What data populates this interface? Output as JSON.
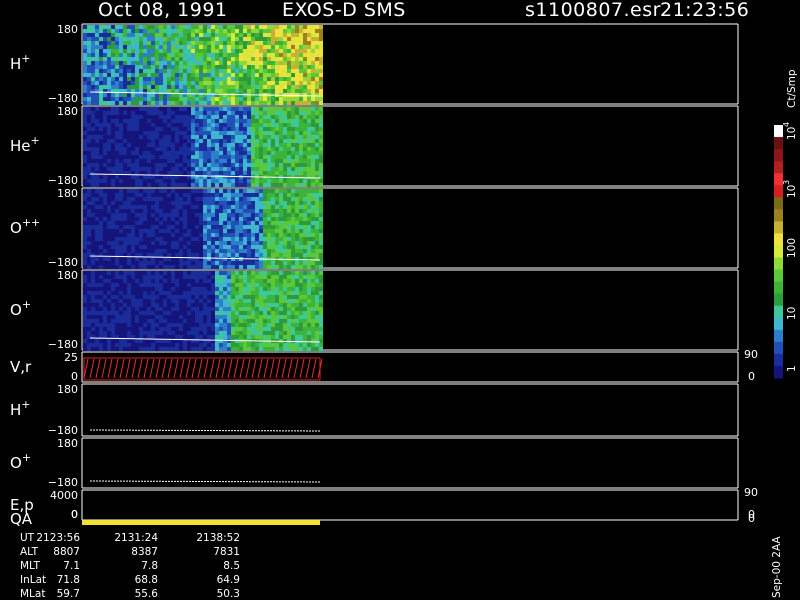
{
  "header": {
    "date": "Oct 08, 1991",
    "mission": "EXOS-D SMS",
    "file": "s1100807.esr",
    "time": "21:23:56"
  },
  "panels": [
    {
      "label": "H",
      "sup": "+",
      "ymax": "180",
      "ymin": "−180"
    },
    {
      "label": "He",
      "sup": "+",
      "ymax": "180",
      "ymin": "−180"
    },
    {
      "label": "O",
      "sup": "++",
      "ymax": "180",
      "ymin": "−180"
    },
    {
      "label": "O",
      "sup": "+",
      "ymax": "180",
      "ymin": "−180"
    },
    {
      "label": "V,r",
      "sup": "",
      "ymax": "25",
      "ymin": "0",
      "rtop": "90",
      "rbot": "0"
    },
    {
      "label": "H",
      "sup": "+",
      "ymax": "180",
      "ymin": "−180"
    },
    {
      "label": "O",
      "sup": "+",
      "ymax": "180",
      "ymin": "−180"
    },
    {
      "label": "E,p",
      "sup": "",
      "ymax": "4000",
      "ymin": "0",
      "rtop": "90",
      "rbot": "0"
    },
    {
      "label": "QA",
      "sup": "",
      "ymax": "",
      "ymin": "0",
      "rtop": "",
      "rbot": "0"
    }
  ],
  "colorbar": {
    "unit": "Ct/Smp",
    "labels": [
      "1",
      "10",
      "100",
      "10^3",
      "10^4"
    ],
    "label_text": {
      "one": "1",
      "ten": "10",
      "hundred": "100",
      "thousand_base": "10",
      "thousand_exp": "3",
      "tenk_base": "10",
      "tenk_exp": "4"
    },
    "colors": [
      "#14147a",
      "#1a2c9a",
      "#2250b8",
      "#2c7fc8",
      "#3fb6d0",
      "#3ec89a",
      "#2f9a3a",
      "#3cb43a",
      "#5bc83a",
      "#8ed83a",
      "#d8e83a",
      "#f0e040",
      "#c8b030",
      "#9a8020",
      "#7a6a18",
      "#d02020",
      "#f03030",
      "#b02020",
      "#8a1818",
      "#6a1010",
      "#ffffff"
    ]
  },
  "footer": {
    "rows": [
      {
        "name": "UT",
        "values": [
          "2123:56",
          "2131:24",
          "2138:52"
        ]
      },
      {
        "name": "ALT",
        "values": [
          "8807",
          "8387",
          "7831"
        ]
      },
      {
        "name": "MLT",
        "values": [
          "7.1",
          "7.8",
          "8.5"
        ]
      },
      {
        "name": "InLat",
        "values": [
          "71.8",
          "68.8",
          "64.9"
        ]
      },
      {
        "name": "MLat",
        "values": [
          "59.7",
          "55.6",
          "50.3"
        ]
      }
    ],
    "stamp": "Sep-00 2AA"
  },
  "chart_data": {
    "type": "heatmap",
    "title": "Oct 08, 1991   EXOS-D SMS",
    "xlabel": "UT",
    "x_ticks": [
      "2123:56",
      "2131:24",
      "2138:52"
    ],
    "color_scale": "log",
    "color_range": [
      1,
      10000
    ],
    "series": [
      {
        "name": "H+",
        "ylim": [
          -180,
          180
        ],
        "dominant_level": "100"
      },
      {
        "name": "He+",
        "ylim": [
          -180,
          180
        ],
        "dominant_level": "1-10"
      },
      {
        "name": "O++",
        "ylim": [
          -180,
          180
        ],
        "dominant_level": "1-10"
      },
      {
        "name": "O+",
        "ylim": [
          -180,
          180
        ],
        "dominant_level": "1-100"
      }
    ],
    "legend": "right"
  }
}
